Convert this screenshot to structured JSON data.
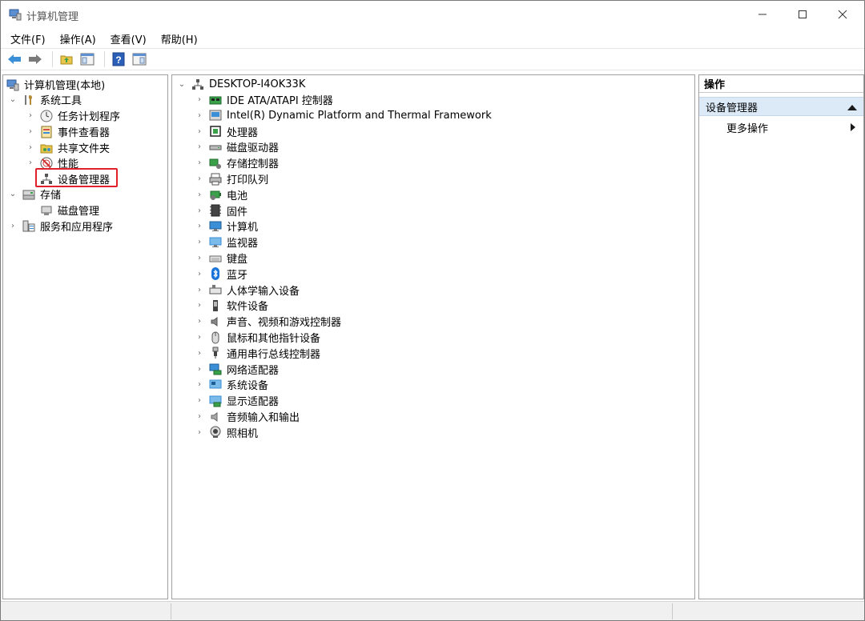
{
  "window": {
    "title": "计算机管理"
  },
  "title_buttons": {
    "min": "—",
    "max": "☐",
    "close": "✕"
  },
  "menu": [
    "文件(F)",
    "操作(A)",
    "查看(V)",
    "帮助(H)"
  ],
  "left_tree": {
    "root": "计算机管理(本地)",
    "system_tools": "系统工具",
    "task_scheduler": "任务计划程序",
    "event_viewer": "事件查看器",
    "shared_folders": "共享文件夹",
    "performance": "性能",
    "device_manager": "设备管理器",
    "storage": "存储",
    "disk_management": "磁盘管理",
    "services_apps": "服务和应用程序"
  },
  "center_tree": {
    "computer_name": "DESKTOP-I4OK33K",
    "devices": [
      {
        "label": "IDE ATA/ATAPI 控制器",
        "icon": "ide-controller-icon"
      },
      {
        "label": "Intel(R) Dynamic Platform and Thermal Framework",
        "icon": "intel-dptf-icon"
      },
      {
        "label": "处理器",
        "icon": "processor-icon"
      },
      {
        "label": "磁盘驱动器",
        "icon": "disk-drive-icon"
      },
      {
        "label": "存储控制器",
        "icon": "storage-controller-icon"
      },
      {
        "label": "打印队列",
        "icon": "print-queue-icon"
      },
      {
        "label": "电池",
        "icon": "battery-icon"
      },
      {
        "label": "固件",
        "icon": "firmware-icon"
      },
      {
        "label": "计算机",
        "icon": "computer-icon"
      },
      {
        "label": "监视器",
        "icon": "monitor-icon"
      },
      {
        "label": "键盘",
        "icon": "keyboard-icon"
      },
      {
        "label": "蓝牙",
        "icon": "bluetooth-icon"
      },
      {
        "label": "人体学输入设备",
        "icon": "hid-icon"
      },
      {
        "label": "软件设备",
        "icon": "software-device-icon"
      },
      {
        "label": "声音、视频和游戏控制器",
        "icon": "sound-icon"
      },
      {
        "label": "鼠标和其他指针设备",
        "icon": "mouse-icon"
      },
      {
        "label": "通用串行总线控制器",
        "icon": "usb-icon"
      },
      {
        "label": "网络适配器",
        "icon": "network-adapter-icon"
      },
      {
        "label": "系统设备",
        "icon": "system-device-icon"
      },
      {
        "label": "显示适配器",
        "icon": "display-adapter-icon"
      },
      {
        "label": "音频输入和输出",
        "icon": "audio-io-icon"
      },
      {
        "label": "照相机",
        "icon": "camera-icon"
      }
    ]
  },
  "actions_pane": {
    "header": "操作",
    "section": "设备管理器",
    "more": "更多操作"
  },
  "colors": {
    "highlight_border": "#e0202a",
    "section_bg": "#dce9f7",
    "monitor_blue": "#3a8fd6"
  }
}
